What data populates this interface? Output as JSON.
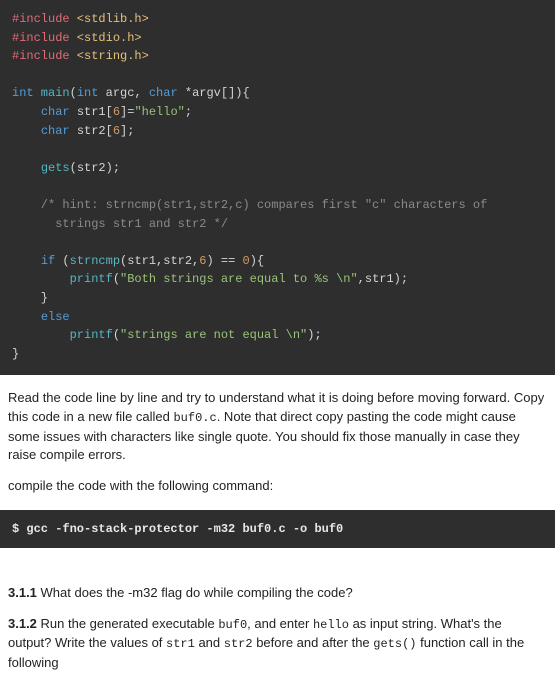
{
  "code": {
    "inc1a": "#include",
    "inc1b": " <stdlib.h>",
    "inc2a": "#include",
    "inc2b": " <stdio.h>",
    "inc3a": "#include",
    "inc3b": " <string.h>",
    "l1": {
      "int": "int",
      "main": " main",
      "lp": "(",
      "intk": "int",
      "argc": " argc, ",
      "chark": "char",
      "args": " *argv[]",
      "rp": ")",
      "ob": "{"
    },
    "l2": {
      "ind": "    ",
      "chark": "char",
      "sp": " ",
      "name": "str1",
      "ob": "[",
      "num": "6",
      "cb": "]=",
      "str": "\"hello\"",
      "sc": ";"
    },
    "l3": {
      "ind": "    ",
      "chark": "char",
      "sp": " ",
      "name": "str2",
      "ob": "[",
      "num": "6",
      "cb": "];"
    },
    "l4": {
      "ind": "    ",
      "fn": "gets",
      "args": "(str2);"
    },
    "cm1": "    /* hint: strncmp(str1,str2,c) compares first ",
    "cm1q": "\"c\"",
    "cm1b": " characters of",
    "cm2": "      strings str1 and str2 */",
    "l5": {
      "ind": "    ",
      "ifk": "if",
      "sp": " (",
      "fn": "strncmp",
      "args": "(str1,str2,",
      "num": "6",
      "rp": ") == ",
      "zero": "0",
      "cb": "){"
    },
    "l6": {
      "ind": "        ",
      "fn": "printf",
      "lp": "(",
      "str": "\"Both strings are equal to %s \\n\"",
      "rest": ",str1);"
    },
    "l7": "    }",
    "l8": {
      "ind": "    ",
      "elsek": "else"
    },
    "l9": {
      "ind": "        ",
      "fn": "printf",
      "lp": "(",
      "str": "\"strings are not equal \\n\"",
      "rp": ");"
    },
    "l10": "}"
  },
  "p1a": "Read the code line by line and try to understand what it is doing before moving forward. Copy this code in a new file called ",
  "p1code": "buf0.c",
  "p1b": ". Note that direct copy pasting the code might cause some issues with characters like single quote. You should fix those manually in case they raise compile errors.",
  "p2": "compile the code with the following command:",
  "cmd": "$ gcc -fno-stack-protector -m32 buf0.c -o buf0",
  "q1num": "3.1.1",
  "q1": " What does the -m32 flag do while compiling the code?",
  "q2num": "3.1.2",
  "q2a": " Run the generated executable ",
  "q2code1": "buf0",
  "q2b": ", and enter ",
  "q2code2": "hello",
  "q2c": " as input string. What's the output? Write the values of ",
  "q2code3": "str1",
  "q2d": " and ",
  "q2code4": "str2",
  "q2e": " before and after the ",
  "q2code5": "gets()",
  "q2f": " function call in the following"
}
